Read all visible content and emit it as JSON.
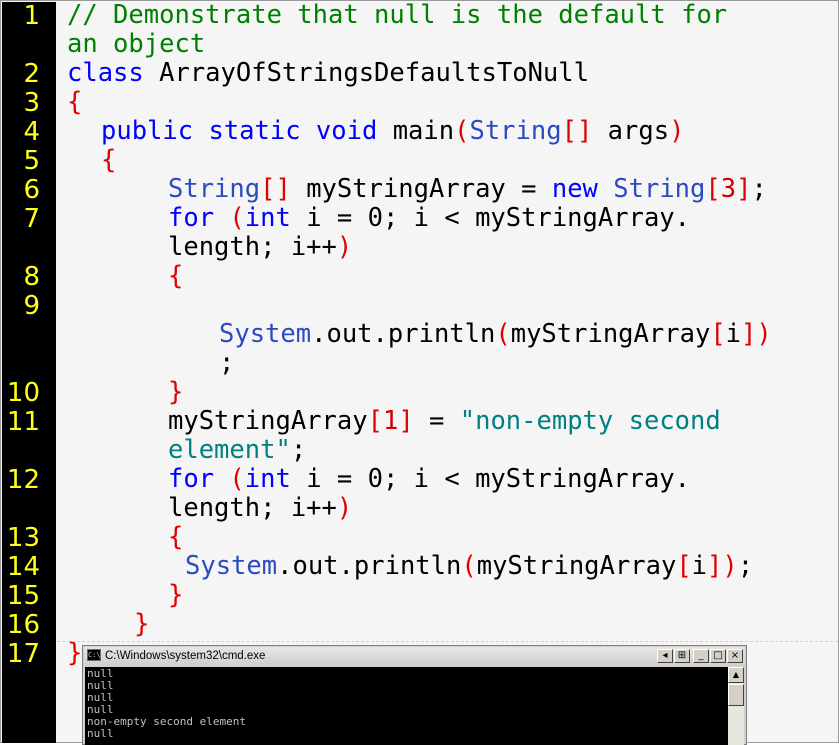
{
  "editor": {
    "line_numbers": [
      "1",
      "2",
      "3",
      "4",
      "5",
      "6",
      "7",
      "8",
      "9",
      "10",
      "11",
      "12",
      "13",
      "14",
      "15",
      "16",
      "17"
    ],
    "lines": {
      "l1a": "// Demonstrate that null is the default for",
      "l1b": "an object",
      "l2_kw": "class",
      "l2_name": " ArrayOfStringsDefaultsToNull",
      "l3": "{",
      "l4_kw": "public static void",
      "l4_name": " main",
      "l4_paren_open": "(",
      "l4_type": "String",
      "l4_brackets": "[]",
      "l4_args": " args",
      "l4_paren_close": ")",
      "l5": "{",
      "l6_type": "String",
      "l6_brackets": "[]",
      "l6_decl": " myStringArray = ",
      "l6_new": "new",
      "l6_space": " ",
      "l6_type2": "String",
      "l6_lb": "[",
      "l6_num": "3",
      "l6_rb": "]",
      "l6_semi": ";",
      "l7_for": "for",
      "l7_space": " ",
      "l7_paren": "(",
      "l7_int": "int",
      "l7_rest": " i = 0; i < myStringArray.",
      "l7b_text": "length; i++",
      "l7b_paren": ")",
      "l8": "{",
      "l9_sys": "System",
      "l9_mid": ".out.println",
      "l9_po": "(",
      "l9_arr": "myStringArray",
      "l9_lb": "[",
      "l9_i": "i",
      "l9_rb": "]",
      "l9_pc": ")",
      "l9b": ";",
      "l10": "}",
      "l11_arr": "myStringArray",
      "l11_lb": "[",
      "l11_num": "1",
      "l11_rb": "]",
      "l11_eq": " = ",
      "l11_str": "\"non-empty second",
      "l11b_str": "element\"",
      "l11b_semi": ";",
      "l12_for": "for",
      "l12_space": " ",
      "l12_paren": "(",
      "l12_int": "int",
      "l12_rest": " i = 0; i < myStringArray.",
      "l12b_text": "length; i++",
      "l12b_paren": ")",
      "l13": "{",
      "l14_sys": "System",
      "l14_mid": ".out.println",
      "l14_po": "(",
      "l14_arr": "myStringArray",
      "l14_lb": "[",
      "l14_i": "i",
      "l14_rb": "]",
      "l14_pc": ")",
      "l14_semi": ";",
      "l15": "}",
      "l16": "}",
      "l17": "}"
    }
  },
  "console": {
    "title": "C:\\Windows\\system32\\cmd.exe",
    "icon_label": "C:\\",
    "buttons": {
      "a": "◂",
      "b": "⊞",
      "minimize": "_",
      "maximize": "□",
      "close": "×"
    },
    "output": [
      "null",
      "null",
      "null",
      "null",
      "non-empty second element",
      "null"
    ],
    "scroll_up": "▲"
  },
  "colors": {
    "gutter_bg": "#000000",
    "line_number": "#ffff1a",
    "comment": "#008000",
    "keyword": "#0000ff",
    "bracket": "#e00000",
    "string": "#008080",
    "editor_bg": "#f5f5f5"
  }
}
